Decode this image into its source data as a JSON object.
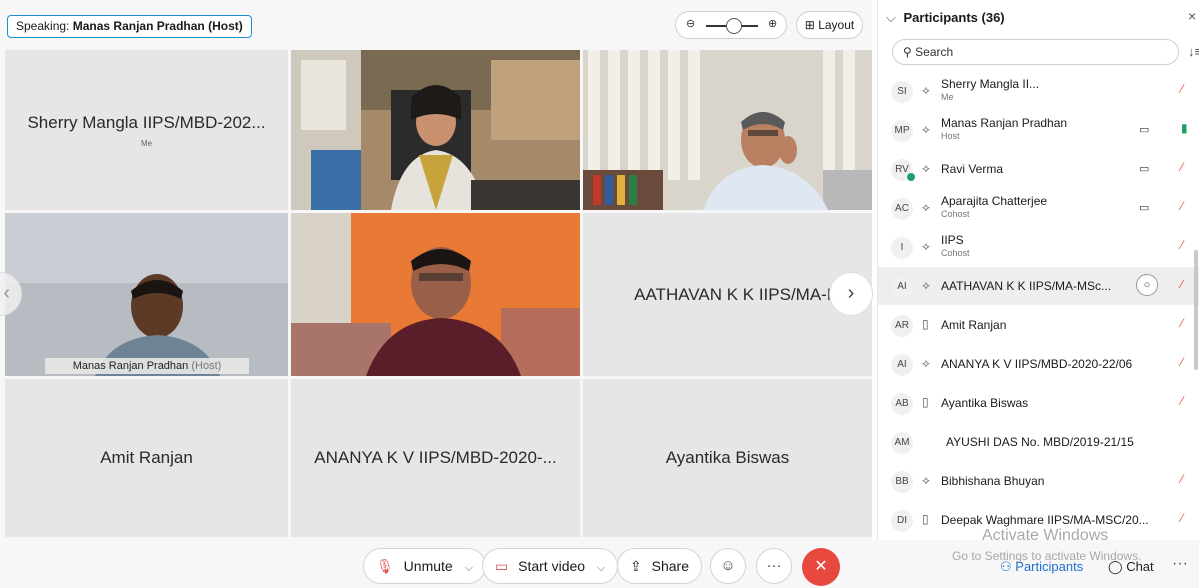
{
  "speaking": {
    "prefix": "Speaking:",
    "name": "Manas Ranjan Pradhan (Host)"
  },
  "toolbar_top": {
    "zoom_out": "⊖",
    "zoom_in": "⊕",
    "layout_label": "Layout",
    "layout_icon": "⊞"
  },
  "grid": {
    "tiles": [
      {
        "name": "Sherry Mangla IIPS/MBD-202...",
        "sub": "Me",
        "type": "name"
      },
      {
        "name": "",
        "type": "video",
        "scene": "woman-office"
      },
      {
        "name": "",
        "type": "video",
        "scene": "man-phone"
      },
      {
        "name": "",
        "type": "video",
        "scene": "manas",
        "tag_name": "Manas Ranjan Pradhan",
        "tag_role": "(Host)"
      },
      {
        "name": "",
        "type": "video",
        "scene": "orange-room"
      },
      {
        "name": "AATHAVAN K K IIPS/MA-MSc",
        "type": "name"
      },
      {
        "name": "Amit Ranjan",
        "type": "name"
      },
      {
        "name": "ANANYA K V IIPS/MBD-2020-...",
        "type": "name"
      },
      {
        "name": "Ayantika Biswas",
        "type": "name"
      }
    ],
    "nav_left": "‹",
    "nav_right": "›"
  },
  "controls": {
    "unmute": "Unmute",
    "start_video": "Start video",
    "share": "Share",
    "reactions_icon": "☺",
    "more_icon": "···",
    "leave_icon": "✕",
    "participants": "Participants",
    "chat": "Chat"
  },
  "watermark": {
    "line1": "Activate Windows",
    "line2": "Go to Settings to activate Windows."
  },
  "panel": {
    "title": "Participants (36)",
    "search_placeholder": "Search",
    "participants": [
      {
        "initials": "SI",
        "name": "Sherry Mangla II...",
        "role": "Me",
        "cam": false,
        "mic_on": false,
        "device": "audio"
      },
      {
        "initials": "MP",
        "name": "Manas Ranjan Pradhan",
        "role": "Host",
        "cam": true,
        "mic_on": true,
        "device": "audio"
      },
      {
        "initials": "RV",
        "name": "Ravi Verma",
        "role": "",
        "cam": true,
        "mic_on": false,
        "device": "audio"
      },
      {
        "initials": "AC",
        "name": "Aparajita Chatterjee",
        "role": "Cohost",
        "cam": true,
        "mic_on": false,
        "device": "audio"
      },
      {
        "initials": "I",
        "name": "IIPS",
        "role": "Cohost",
        "cam": false,
        "mic_on": false,
        "device": "audio"
      },
      {
        "initials": "AI",
        "name": "AATHAVAN K K IIPS/MA-MSc...",
        "role": "",
        "cam": false,
        "mic_on": false,
        "device": "audio",
        "selected": true
      },
      {
        "initials": "AR",
        "name": "Amit Ranjan",
        "role": "",
        "cam": false,
        "mic_on": false,
        "device": "phone"
      },
      {
        "initials": "AI",
        "name": "ANANYA K V IIPS/MBD-2020-22/06",
        "role": "",
        "cam": false,
        "mic_on": false,
        "device": "audio"
      },
      {
        "initials": "AB",
        "name": "Ayantika Biswas",
        "role": "",
        "cam": false,
        "mic_on": false,
        "device": "phone"
      },
      {
        "initials": "AM",
        "name": "AYUSHI DAS No. MBD/2019-21/15",
        "role": "",
        "cam": false,
        "mic_on": null,
        "device": "none"
      },
      {
        "initials": "BB",
        "name": "Bibhishana Bhuyan",
        "role": "",
        "cam": false,
        "mic_on": false,
        "device": "audio"
      },
      {
        "initials": "DI",
        "name": "Deepak Waghmare IIPS/MA-MSC/20...",
        "role": "",
        "cam": false,
        "mic_on": false,
        "device": "phone"
      }
    ]
  },
  "colors": {
    "accent": "#1b8fd6",
    "leave": "#e8493f",
    "muted": "#e0573a",
    "unmuted": "#19a15a"
  }
}
